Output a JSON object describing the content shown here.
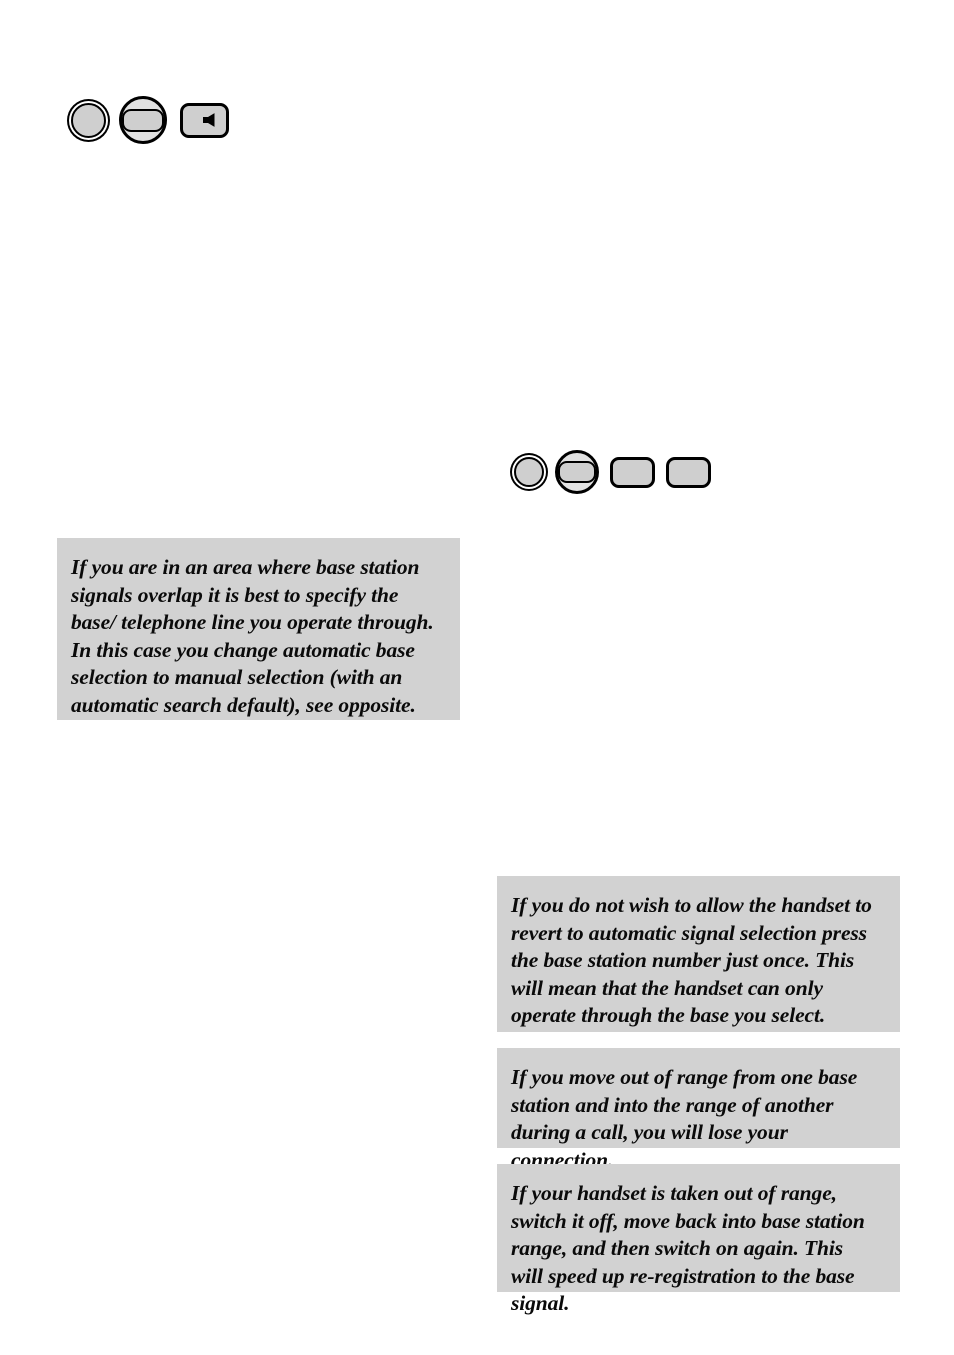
{
  "page": {
    "background_color": "#ffffff",
    "note_background_color": "#d2d2d2"
  },
  "key_rows": [
    {
      "name": "top-key-row",
      "keys": [
        {
          "icon": "circle-button-icon",
          "label": ""
        },
        {
          "icon": "oval-in-circle-button-icon",
          "label": ""
        },
        {
          "icon": "speaker-button-icon",
          "label": ""
        }
      ]
    },
    {
      "name": "middle-key-row",
      "keys": [
        {
          "icon": "circle-button-icon",
          "label": ""
        },
        {
          "icon": "oval-in-circle-button-icon",
          "label": ""
        },
        {
          "icon": "blank-rectangle-button-icon",
          "label": ""
        },
        {
          "icon": "blank-rectangle-button-icon",
          "label": ""
        }
      ]
    }
  ],
  "notes": {
    "overlap": "If you are in an area where base station signals overlap it is best to specify the base/ telephone line you operate through. In this case you change automatic base selection to manual selection (with an automatic search default), see opposite.",
    "no_revert": "If you do not wish to allow the handset to revert to automatic signal selection press the base station number just once. This will mean that the handset can only operate through the base you select.",
    "out_of_range": "If you move out of range from one base station and into the range of another during a call, you will lose your connection.",
    "switch_off": "If your handset is taken out of range, switch it off, move back into base station range, and then switch on again. This will speed up re-registration to the base signal."
  }
}
